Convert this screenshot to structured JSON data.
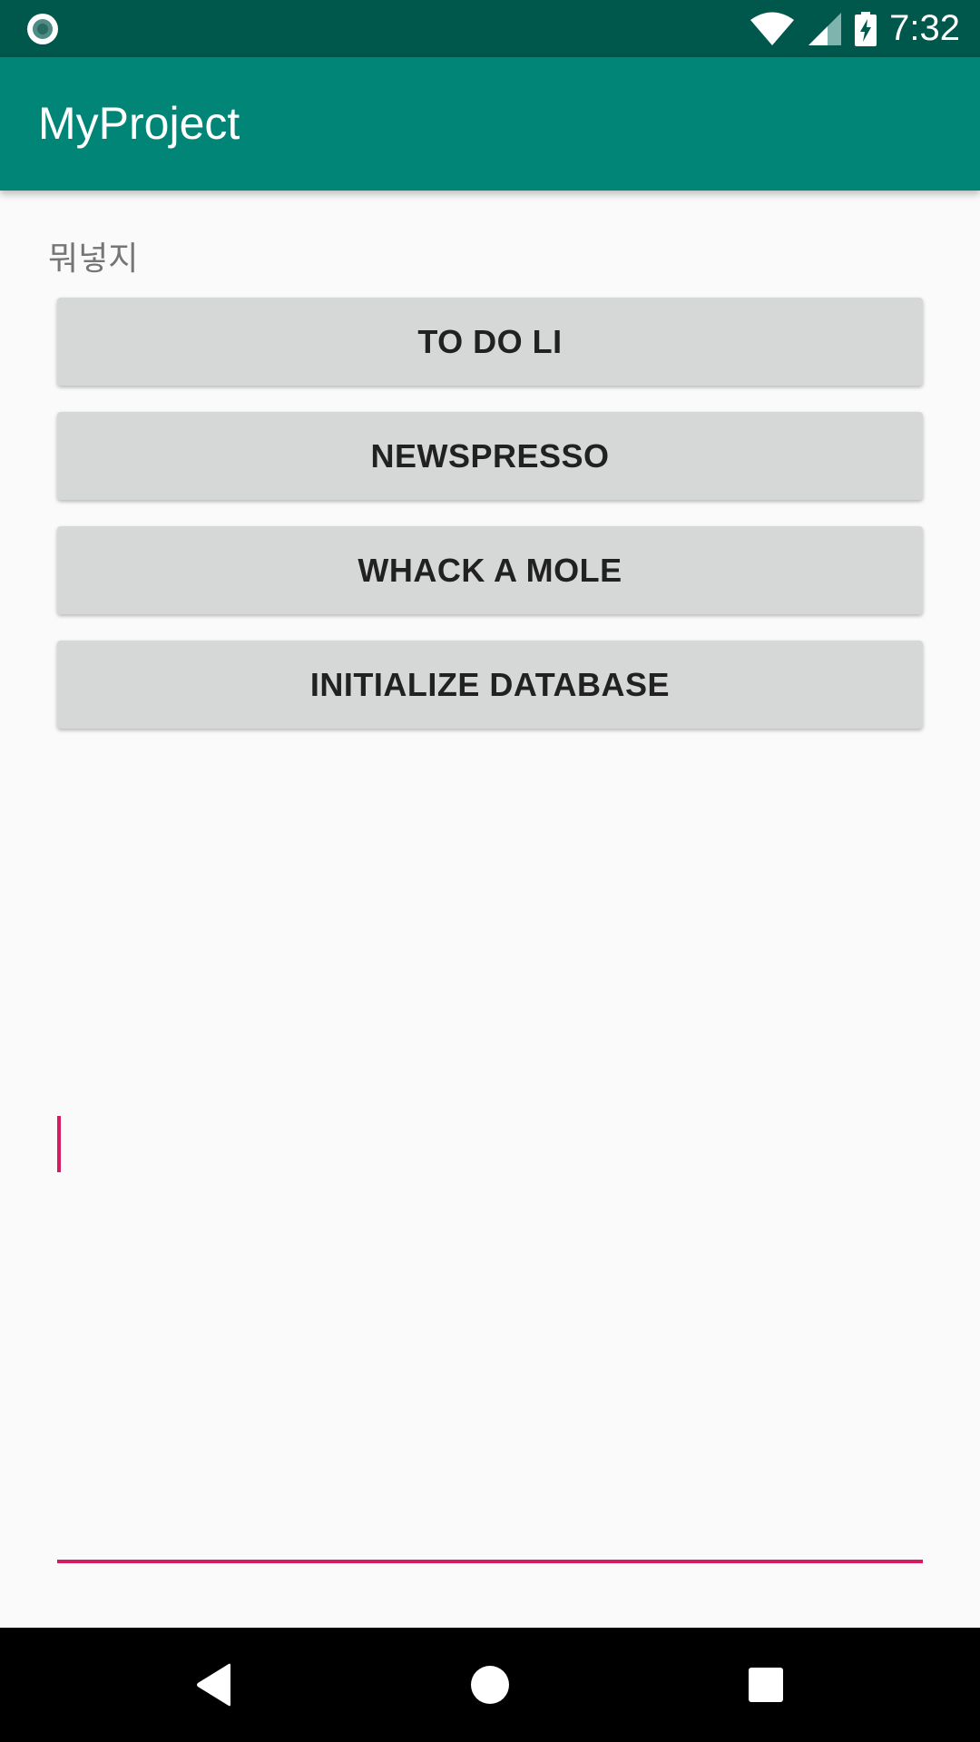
{
  "status_bar": {
    "time": "7:32",
    "icons": [
      "app-notification-icon",
      "wifi-icon",
      "cell-signal-icon",
      "battery-charging-icon"
    ]
  },
  "app_bar": {
    "title": "MyProject"
  },
  "main": {
    "label": "뭐넣지",
    "buttons": [
      {
        "label": "TO DO LI"
      },
      {
        "label": "NEWSPRESSO"
      },
      {
        "label": "WHACK A MOLE"
      },
      {
        "label": "INITIALIZE DATABASE"
      }
    ],
    "edit_text": {
      "value": "",
      "placeholder": ""
    }
  },
  "nav_bar": {
    "icons": [
      "back-icon",
      "home-icon",
      "recents-icon"
    ]
  },
  "colors": {
    "status_bar": "#00574b",
    "app_bar": "#008577",
    "accent": "#d81b60",
    "button_bg": "#d6d7d7",
    "background": "#fafafa"
  }
}
